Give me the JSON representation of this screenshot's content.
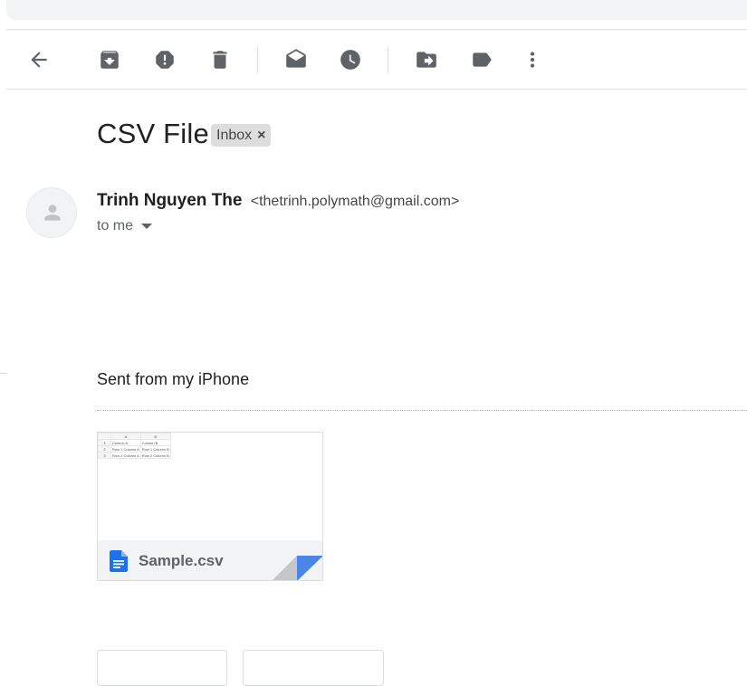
{
  "toolbar": {
    "icons": [
      "back-arrow-icon",
      "archive-icon",
      "report-spam-icon",
      "delete-icon",
      "mark-unread-icon",
      "snooze-icon",
      "move-to-icon",
      "label-icon",
      "more-vert-icon"
    ],
    "icon_color": "#5f6368"
  },
  "email": {
    "subject": "CSV File",
    "label": "Inbox",
    "label_remove": "×",
    "sender_name": "Trinh Nguyen The",
    "sender_email": "<thetrinh.polymath@gmail.com>",
    "recipient": "to me",
    "body": "Sent from my iPhone"
  },
  "attachment": {
    "file_name": "Sample.csv",
    "icon": "google-doc-icon",
    "icon_color": "#1a73e8",
    "preview": {
      "column_letters": [
        "",
        "A",
        "B"
      ],
      "rows": [
        [
          "1",
          "Column A",
          "Column B"
        ],
        [
          "2",
          "Row 1 Column A",
          "Row 1 Column B"
        ],
        [
          "3",
          "Row 2 Column A",
          "Row 2 Column B"
        ]
      ]
    }
  },
  "colors": {
    "search_bar": "#f1f3f4",
    "chip_bg": "#dddddd",
    "accent_blue": "#4a86e8"
  }
}
